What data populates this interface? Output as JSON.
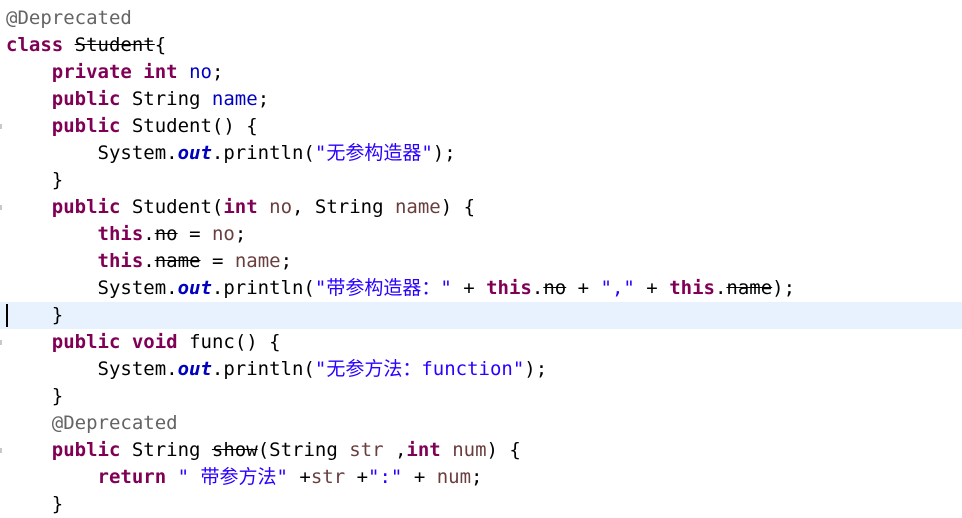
{
  "editor": {
    "lines": [
      {
        "tokens": [
          {
            "t": "ann",
            "v": "@Deprecated"
          }
        ]
      },
      {
        "tokens": [
          {
            "t": "kw",
            "v": "class"
          },
          {
            "t": "",
            "v": " "
          },
          {
            "t": "dep",
            "v": "Student"
          },
          {
            "t": "",
            "v": "{"
          }
        ]
      },
      {
        "tokens": [
          {
            "t": "",
            "v": "    "
          },
          {
            "t": "kw",
            "v": "private"
          },
          {
            "t": "",
            "v": " "
          },
          {
            "t": "kw",
            "v": "int"
          },
          {
            "t": "",
            "v": " "
          },
          {
            "t": "field",
            "v": "no"
          },
          {
            "t": "",
            "v": ";"
          }
        ]
      },
      {
        "tokens": [
          {
            "t": "",
            "v": "    "
          },
          {
            "t": "kw",
            "v": "public"
          },
          {
            "t": "",
            "v": " String "
          },
          {
            "t": "field",
            "v": "name"
          },
          {
            "t": "",
            "v": ";"
          }
        ]
      },
      {
        "tokens": [
          {
            "t": "",
            "v": "    "
          },
          {
            "t": "kw",
            "v": "public"
          },
          {
            "t": "",
            "v": " Student() {"
          }
        ]
      },
      {
        "tokens": [
          {
            "t": "",
            "v": "        System."
          },
          {
            "t": "static-field",
            "v": "out"
          },
          {
            "t": "",
            "v": ".println("
          },
          {
            "t": "str",
            "v": "\"无参构造器\""
          },
          {
            "t": "",
            "v": ");"
          }
        ]
      },
      {
        "tokens": [
          {
            "t": "",
            "v": "    }"
          }
        ]
      },
      {
        "tokens": [
          {
            "t": "",
            "v": "    "
          },
          {
            "t": "kw",
            "v": "public"
          },
          {
            "t": "",
            "v": " Student("
          },
          {
            "t": "kw",
            "v": "int"
          },
          {
            "t": "",
            "v": " "
          },
          {
            "t": "param",
            "v": "no"
          },
          {
            "t": "",
            "v": ", String "
          },
          {
            "t": "param",
            "v": "name"
          },
          {
            "t": "",
            "v": ") {"
          }
        ]
      },
      {
        "tokens": [
          {
            "t": "",
            "v": "        "
          },
          {
            "t": "kw",
            "v": "this"
          },
          {
            "t": "",
            "v": "."
          },
          {
            "t": "dep",
            "v": "no"
          },
          {
            "t": "",
            "v": " = "
          },
          {
            "t": "param",
            "v": "no"
          },
          {
            "t": "",
            "v": ";"
          }
        ]
      },
      {
        "tokens": [
          {
            "t": "",
            "v": "        "
          },
          {
            "t": "kw",
            "v": "this"
          },
          {
            "t": "",
            "v": "."
          },
          {
            "t": "dep",
            "v": "name"
          },
          {
            "t": "",
            "v": " = "
          },
          {
            "t": "param",
            "v": "name"
          },
          {
            "t": "",
            "v": ";"
          }
        ]
      },
      {
        "tokens": [
          {
            "t": "",
            "v": "        System."
          },
          {
            "t": "static-field",
            "v": "out"
          },
          {
            "t": "",
            "v": ".println("
          },
          {
            "t": "str",
            "v": "\"带参构造器：\""
          },
          {
            "t": "",
            "v": " + "
          },
          {
            "t": "kw",
            "v": "this"
          },
          {
            "t": "",
            "v": "."
          },
          {
            "t": "dep",
            "v": "no"
          },
          {
            "t": "",
            "v": " + "
          },
          {
            "t": "str",
            "v": "\",\""
          },
          {
            "t": "",
            "v": " + "
          },
          {
            "t": "kw",
            "v": "this"
          },
          {
            "t": "",
            "v": "."
          },
          {
            "t": "dep",
            "v": "name"
          },
          {
            "t": "",
            "v": ");"
          }
        ]
      },
      {
        "tokens": [
          {
            "t": "",
            "v": "    }"
          }
        ]
      },
      {
        "tokens": [
          {
            "t": "",
            "v": "    "
          },
          {
            "t": "kw",
            "v": "public"
          },
          {
            "t": "",
            "v": " "
          },
          {
            "t": "kw",
            "v": "void"
          },
          {
            "t": "",
            "v": " func() {"
          }
        ]
      },
      {
        "tokens": [
          {
            "t": "",
            "v": "        System."
          },
          {
            "t": "static-field",
            "v": "out"
          },
          {
            "t": "",
            "v": ".println("
          },
          {
            "t": "str",
            "v": "\"无参方法：function\""
          },
          {
            "t": "",
            "v": ");"
          }
        ]
      },
      {
        "tokens": [
          {
            "t": "",
            "v": "    }"
          }
        ]
      },
      {
        "tokens": [
          {
            "t": "",
            "v": "    "
          },
          {
            "t": "ann",
            "v": "@Deprecated"
          }
        ]
      },
      {
        "tokens": [
          {
            "t": "",
            "v": "    "
          },
          {
            "t": "kw",
            "v": "public"
          },
          {
            "t": "",
            "v": " String "
          },
          {
            "t": "dep",
            "v": "show"
          },
          {
            "t": "",
            "v": "(String "
          },
          {
            "t": "param",
            "v": "str"
          },
          {
            "t": "",
            "v": " ,"
          },
          {
            "t": "kw",
            "v": "int"
          },
          {
            "t": "",
            "v": " "
          },
          {
            "t": "param",
            "v": "num"
          },
          {
            "t": "",
            "v": ") {"
          }
        ]
      },
      {
        "tokens": [
          {
            "t": "",
            "v": "        "
          },
          {
            "t": "kw",
            "v": "return"
          },
          {
            "t": "",
            "v": " "
          },
          {
            "t": "str",
            "v": "\" 带参方法\""
          },
          {
            "t": "",
            "v": " +"
          },
          {
            "t": "param",
            "v": "str"
          },
          {
            "t": "",
            "v": " +"
          },
          {
            "t": "str",
            "v": "\":\""
          },
          {
            "t": "",
            "v": " + "
          },
          {
            "t": "param",
            "v": "num"
          },
          {
            "t": "",
            "v": ";"
          }
        ]
      },
      {
        "tokens": [
          {
            "t": "",
            "v": "    }"
          }
        ]
      }
    ],
    "current_line": 11,
    "colors": {
      "keyword": "#7f0055",
      "field": "#0000c0",
      "string": "#2a00ff",
      "annotation": "#646464",
      "current_line_bg": "#e8f2fe"
    }
  }
}
